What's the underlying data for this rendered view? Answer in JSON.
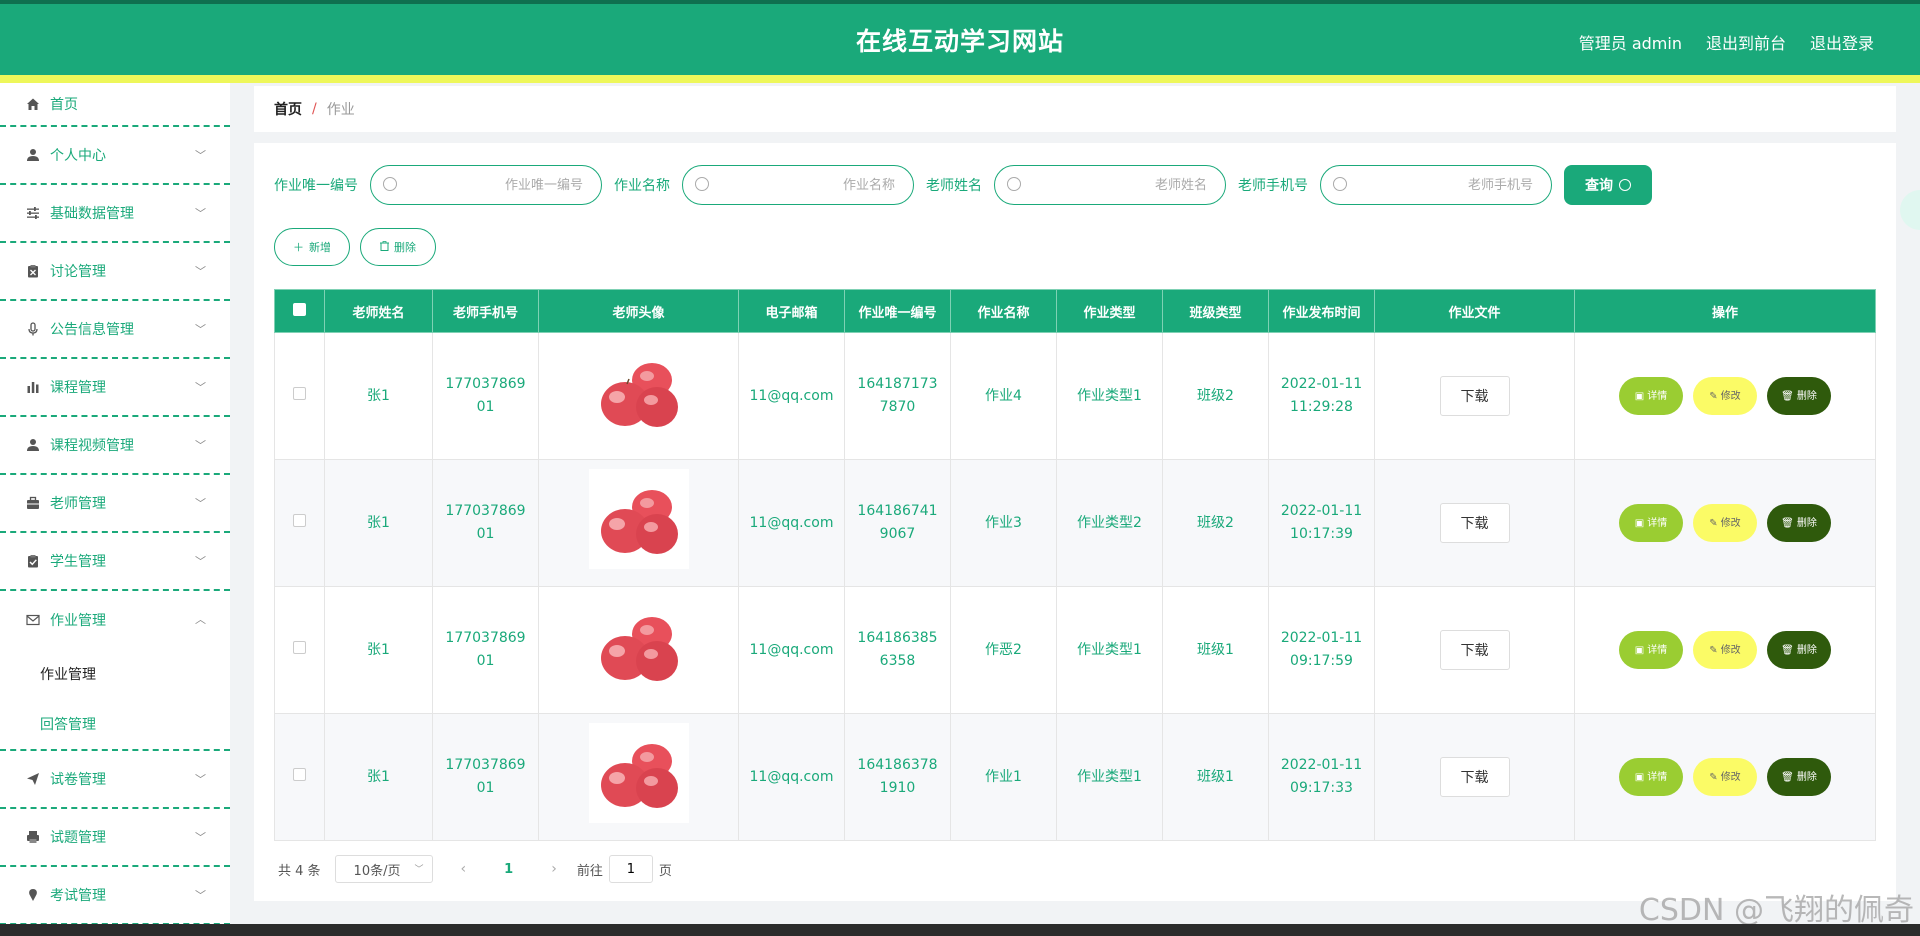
{
  "header": {
    "title": "在线互动学习网站",
    "admin_label": "管理员 admin",
    "to_front": "退出到前台",
    "logout": "退出登录"
  },
  "sidebar": {
    "items": [
      {
        "label": "首页",
        "icon": "home-icon"
      },
      {
        "label": "个人中心",
        "icon": "user-icon"
      },
      {
        "label": "基础数据管理",
        "icon": "sliders-icon"
      },
      {
        "label": "讨论管理",
        "icon": "clipboard-icon"
      },
      {
        "label": "公告信息管理",
        "icon": "microphone-icon"
      },
      {
        "label": "课程管理",
        "icon": "bar-chart-icon"
      },
      {
        "label": "课程视频管理",
        "icon": "user-icon"
      },
      {
        "label": "老师管理",
        "icon": "briefcase-icon"
      },
      {
        "label": "学生管理",
        "icon": "clipboard-check-icon"
      },
      {
        "label": "作业管理",
        "icon": "mail-icon"
      },
      {
        "label": "试卷管理",
        "icon": "paper-plane-icon"
      },
      {
        "label": "试题管理",
        "icon": "printer-icon"
      },
      {
        "label": "考试管理",
        "icon": "pin-icon"
      }
    ],
    "sub_items": [
      "作业管理",
      "回答管理"
    ]
  },
  "breadcrumb": {
    "home": "首页",
    "sep": "/",
    "current": "作业"
  },
  "search": {
    "fields": [
      {
        "label": "作业唯一编号",
        "placeholder": "作业唯一编号"
      },
      {
        "label": "作业名称",
        "placeholder": "作业名称"
      },
      {
        "label": "老师姓名",
        "placeholder": "老师姓名"
      },
      {
        "label": "老师手机号",
        "placeholder": "老师手机号"
      }
    ],
    "button": "查询"
  },
  "actions": {
    "add": "新增",
    "delete": "删除"
  },
  "table": {
    "headers": [
      "老师姓名",
      "老师手机号",
      "老师头像",
      "电子邮箱",
      "作业唯一编号",
      "作业名称",
      "作业类型",
      "班级类型",
      "作业发布时间",
      "作业文件",
      "操作"
    ],
    "rows": [
      {
        "teacher": "张1",
        "phone": "17703786901",
        "email": "11@qq.com",
        "code": "1641871737870",
        "name": "作业4",
        "type": "作业类型1",
        "class": "班级2",
        "time": "2022-01-11 11:29:28"
      },
      {
        "teacher": "张1",
        "phone": "17703786901",
        "email": "11@qq.com",
        "code": "1641867419067",
        "name": "作业3",
        "type": "作业类型2",
        "class": "班级2",
        "time": "2022-01-11 10:17:39"
      },
      {
        "teacher": "张1",
        "phone": "17703786901",
        "email": "11@qq.com",
        "code": "1641863856358",
        "name": "作恶2",
        "type": "作业类型1",
        "class": "班级1",
        "time": "2022-01-11 09:17:59"
      },
      {
        "teacher": "张1",
        "phone": "17703786901",
        "email": "11@qq.com",
        "code": "1641863781910",
        "name": "作业1",
        "type": "作业类型1",
        "class": "班级1",
        "time": "2022-01-11 09:17:33"
      }
    ],
    "download": "下载",
    "ops": {
      "detail": "详情",
      "edit": "修改",
      "delete": "删除"
    }
  },
  "pager": {
    "total": "共 4 条",
    "size": "10条/页",
    "page": "1",
    "goto": "前往",
    "goto_value": "1",
    "page_unit": "页"
  },
  "watermark": "CSDN @飞翔的佩奇",
  "colors": {
    "primary": "#1aa97a",
    "accent_yellow": "#eef75a",
    "detail": "#9acd32",
    "edit": "#fbfb66",
    "delete": "#2f5a0c"
  }
}
